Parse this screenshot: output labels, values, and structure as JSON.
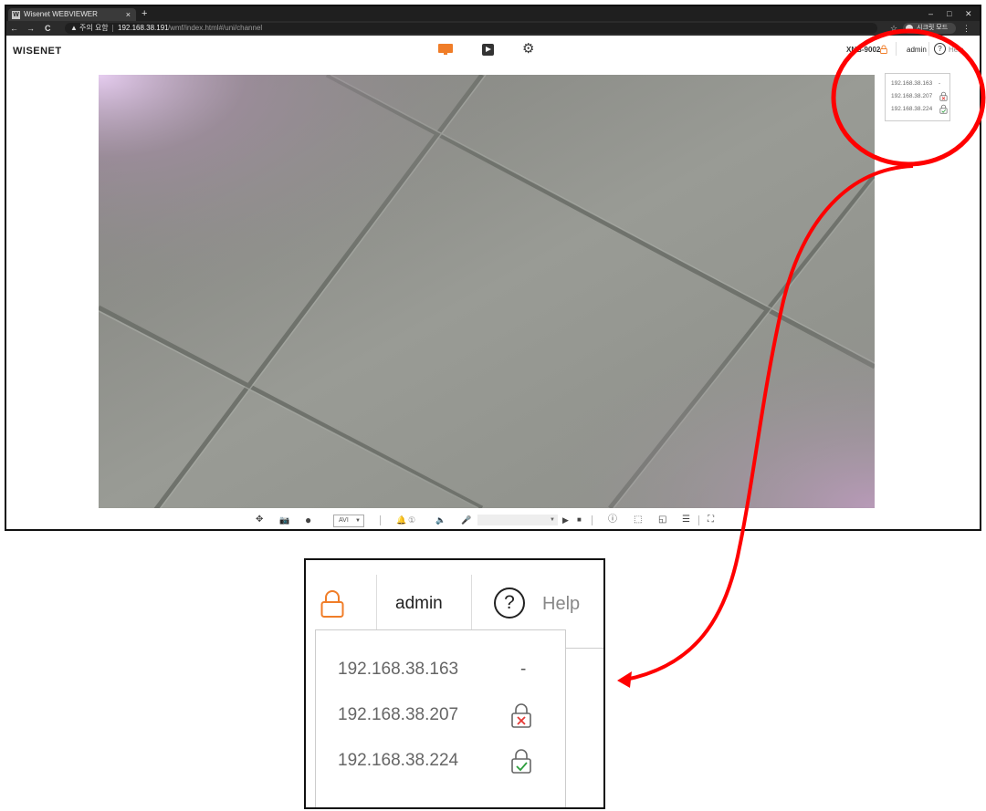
{
  "browser": {
    "tab_title": "Wisenet WEBVIEWER",
    "tab_favicon": "W",
    "tab_close": "×",
    "new_tab": "+",
    "nav_back": "←",
    "nav_forward": "→",
    "nav_reload": "C",
    "security_warning": "▲",
    "security_note": "주의 요함",
    "url_host": "192.168.38.191",
    "url_path": "/wmf/index.html#/uni/channel",
    "bookmark_star": "☆",
    "incognito_label": "시크릿 모드",
    "menu_kebab": "⋮",
    "win_min": "–",
    "win_max": "□",
    "win_close": "✕"
  },
  "app": {
    "logo": "WISENET",
    "menu_icons": [
      "monitor-icon",
      "playback-icon",
      "settings-icon"
    ],
    "gear_glyph": "⚙",
    "model": "XNB-9002",
    "user": "admin",
    "help_glyph": "?",
    "help_label": "Help"
  },
  "dropdown": {
    "items": [
      {
        "ip": "192.168.38.163",
        "status": "-"
      },
      {
        "ip": "192.168.38.207",
        "status": "lock-failed-icon"
      },
      {
        "ip": "192.168.38.224",
        "status": "lock-ok-icon"
      }
    ]
  },
  "toolbar": {
    "ptz_glyph": "✥",
    "snapshot_glyph": "📷",
    "rec_glyph": "●",
    "format_select": "AVI",
    "format_caret": "▼",
    "alarm_glyph": "🔔",
    "alarm_count": "①",
    "speaker_glyph": "🔈",
    "mic_glyph": "🎤",
    "select_caret": "▼",
    "play_glyph": "▶",
    "stop_glyph": "■",
    "info_glyph": "ⓘ",
    "area_glyph": "⬚",
    "aspect_glyph": "◱",
    "adjust_glyph": "☰",
    "fullscreen_glyph": "⛶"
  },
  "colors": {
    "accent": "#f07d28",
    "annotation": "#ff0000",
    "fail": "#e53935",
    "ok": "#2e9e3e"
  }
}
